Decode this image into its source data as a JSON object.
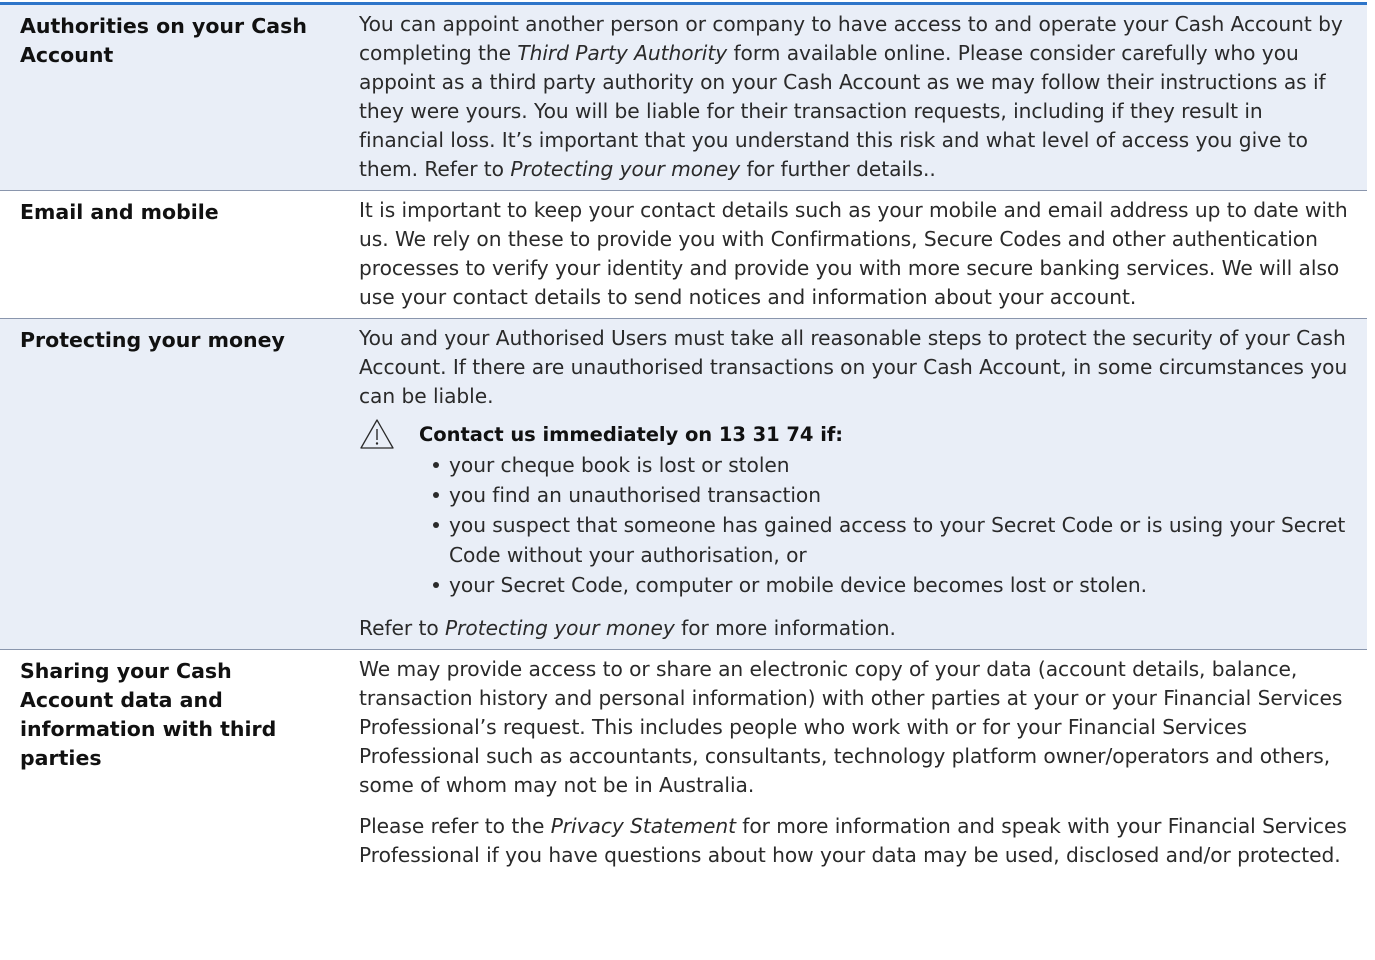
{
  "colors": {
    "accent_rule": "#2e75c9",
    "shaded_row": "#e9eef7",
    "row_border": "#8a96ad"
  },
  "rows": [
    {
      "heading": "Authorities on your Cash Account",
      "text_a": "You can appoint another person or company to have access to and operate your Cash Account by completing the ",
      "italic_a": "Third Party Authority",
      "text_b": " form available online. Please consider carefully who you appoint as a third party authority on your Cash Account as we may follow their instructions as if they were yours. You will be liable for their transaction requests, including if they result in financial loss. It’s important that you understand this risk and what level of access you give to them. Refer to ",
      "italic_b": "Protecting your money",
      "text_c": " for further details.."
    },
    {
      "heading": "Email and mobile",
      "text": "It is important to keep your contact details such as your mobile and email address up to date with us. We rely on these to provide you with Confirmations, Secure Codes and other authentication processes to verify your identity and provide you with more secure banking services. We will also use your contact details to send notices and information about your account."
    },
    {
      "heading": "Protecting your money",
      "text": "You and your Authorised Users must take all reasonable steps to protect the security of your Cash Account. If there are unauthorised transactions on your Cash Account, in some circumstances you can be liable.",
      "warning_icon": "warning-triangle-icon",
      "warning_title": "Contact us immediately on 13 31 74 if:",
      "bullets": [
        "your cheque book is lost or stolen",
        "you find an unauthorised transaction",
        "you suspect that someone has gained access to your Secret Code or is using your Secret Code without your authorisation, or",
        "your Secret Code, computer or mobile device becomes lost or stolen."
      ],
      "refer_a": "Refer to ",
      "refer_italic": "Protecting your money",
      "refer_b": " for more information."
    },
    {
      "heading": "Sharing your Cash Account data and information with third parties",
      "text": "We may provide access to or share an electronic copy of your data (account details, balance, transaction history and personal information) with other parties at your or your Financial Services Professional’s request. This includes people who work with or for your Financial Services Professional such as accountants, consultants, technology platform owner/operators and others, some of whom may not be in Australia.",
      "text2_a": "Please refer to the ",
      "text2_italic": "Privacy Statement",
      "text2_b": " for more information and speak with your Financial Services Professional if you have questions about how your data may be used, disclosed and/or protected."
    }
  ]
}
